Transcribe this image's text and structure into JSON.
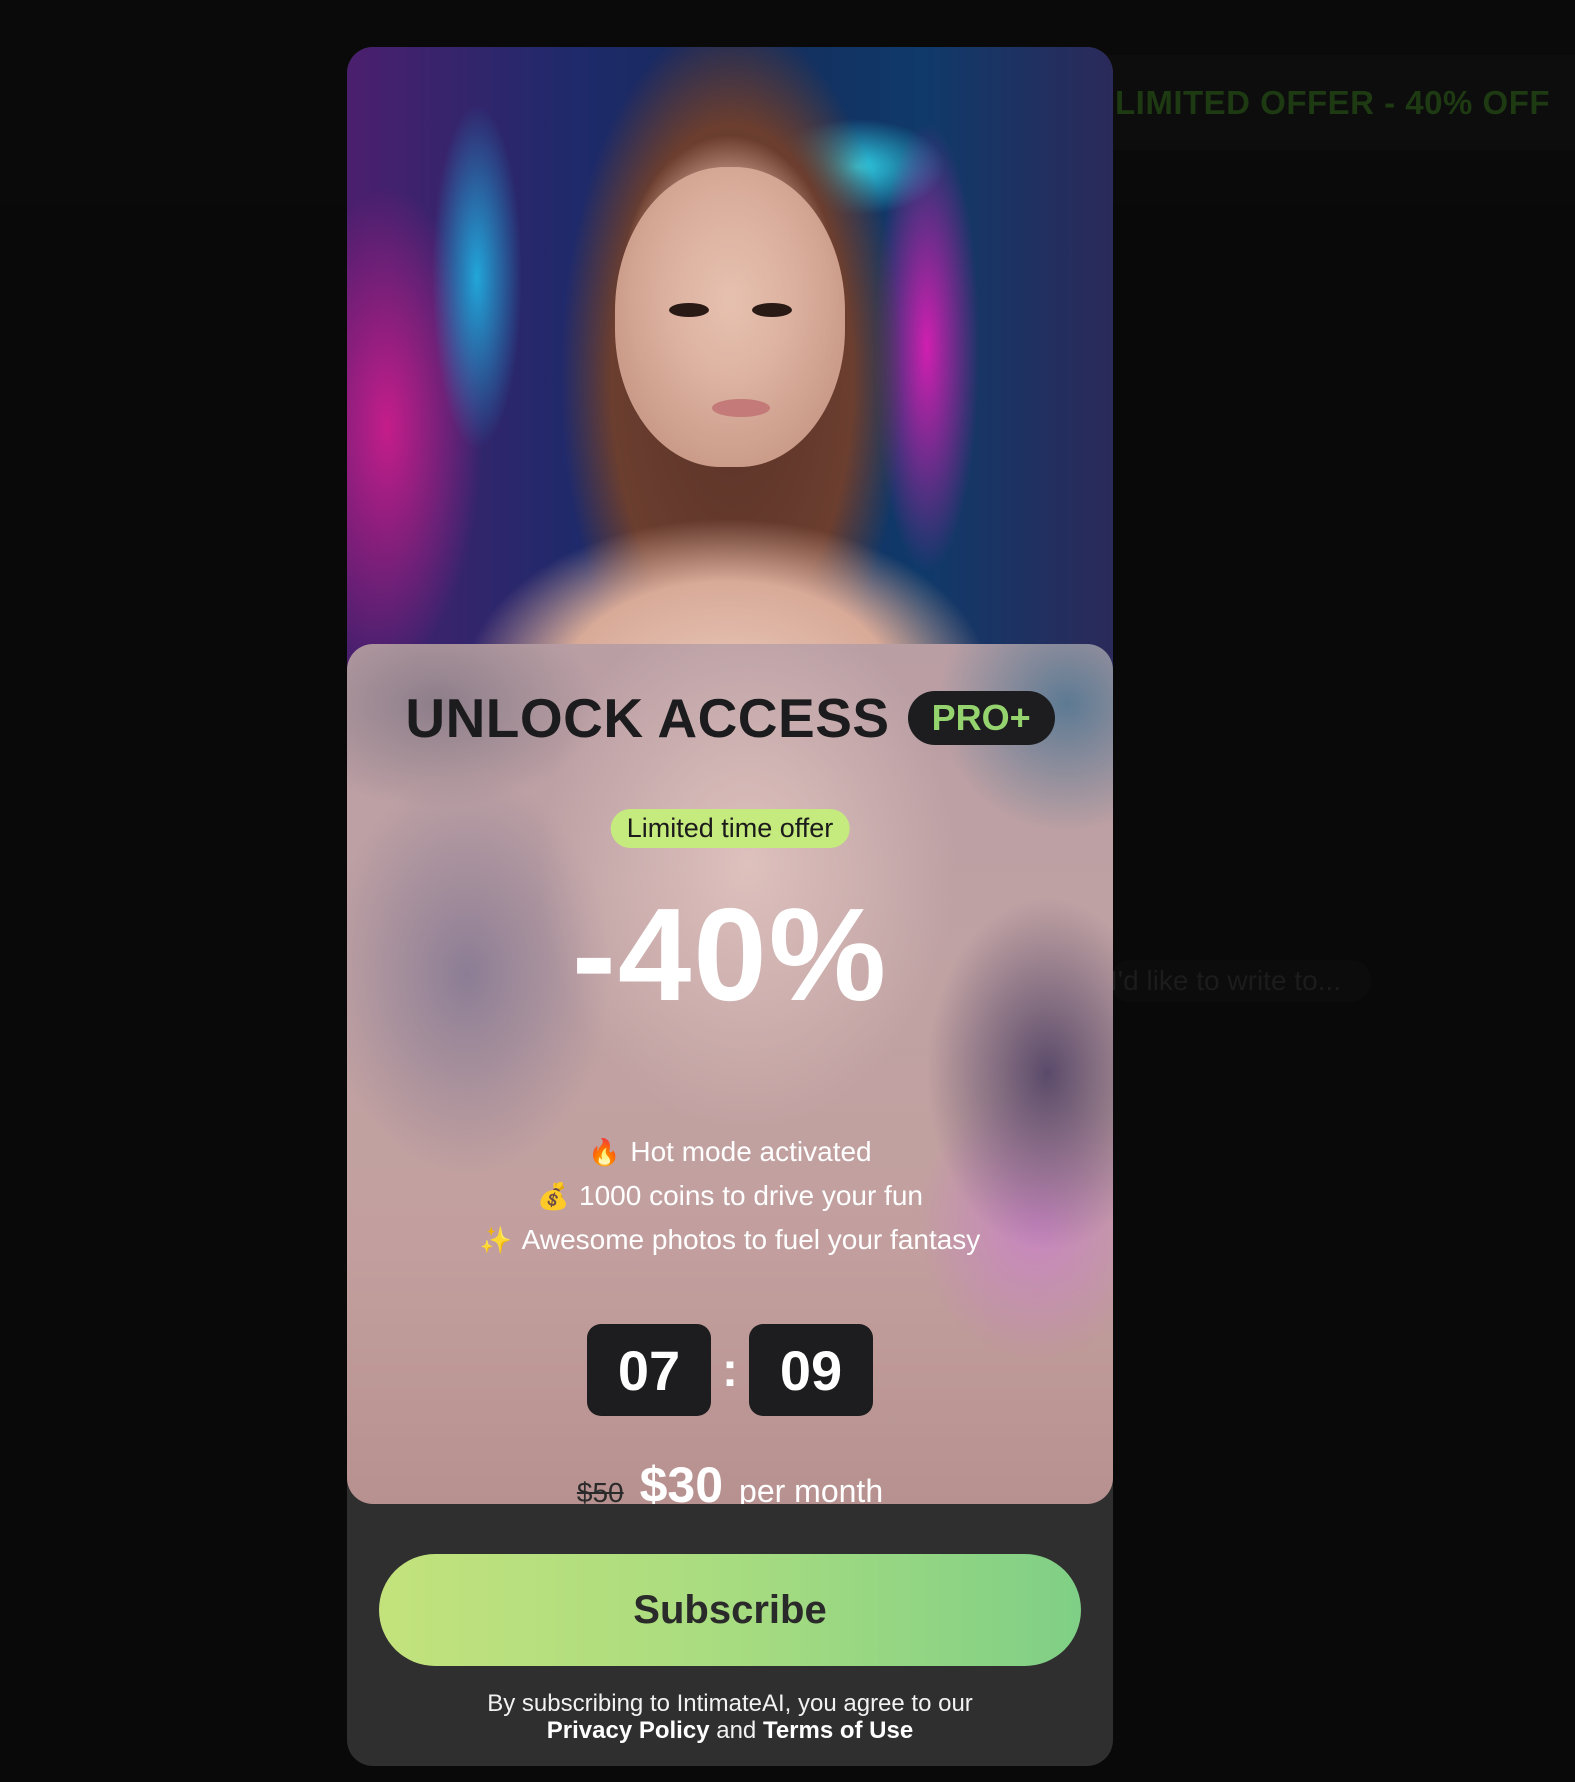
{
  "background": {
    "banner_text": "LIMITED OFFER - 40% OFF",
    "hint_text": "I'd like to write to..."
  },
  "modal": {
    "title": "UNLOCK ACCESS",
    "badge": "PRO+",
    "offer_pill": "Limited time offer",
    "discount": "-40%",
    "features": [
      {
        "icon": "fire-icon",
        "glyph": "🔥",
        "text": "Hot mode activated"
      },
      {
        "icon": "money-bag-icon",
        "glyph": "💰",
        "text": "1000 coins to drive your fun"
      },
      {
        "icon": "sparkles-icon",
        "glyph": "✨",
        "text": "Awesome photos to fuel your fantasy"
      }
    ],
    "timer": {
      "minutes": "07",
      "separator": ":",
      "seconds": "09"
    },
    "price": {
      "old": "$50",
      "new": "$30",
      "period": "per month"
    },
    "subscribe_label": "Subscribe",
    "legal": {
      "prefix": "By subscribing to IntimateAI, you agree to our",
      "privacy_label": "Privacy Policy",
      "conjunction": "and",
      "terms_label": "Terms of Use"
    }
  },
  "colors": {
    "accent_green": "#94d36e",
    "pill_green": "#c5ea7d",
    "button_gradient_start": "#c3e27c",
    "button_gradient_end": "#7fcf86",
    "dark_box": "#1d1d1f"
  }
}
